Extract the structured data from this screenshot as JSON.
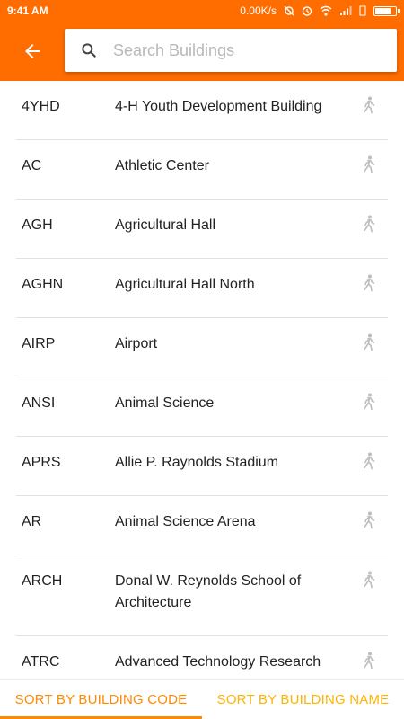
{
  "status_bar": {
    "time": "9:41 AM",
    "network_speed": "0.00K/s",
    "battery_level": 0.8
  },
  "header": {
    "back_icon": "arrow-back-icon",
    "search": {
      "icon": "search-icon",
      "placeholder": "Search Buildings",
      "value": ""
    }
  },
  "buildings": [
    {
      "code": "4YHD",
      "name": "4-H Youth Development Building"
    },
    {
      "code": "AC",
      "name": "Athletic Center"
    },
    {
      "code": "AGH",
      "name": "Agricultural Hall"
    },
    {
      "code": "AGHN",
      "name": "Agricultural Hall North"
    },
    {
      "code": "AIRP",
      "name": "Airport"
    },
    {
      "code": "ANSI",
      "name": "Animal Science"
    },
    {
      "code": "APRS",
      "name": "Allie P. Raynolds Stadium"
    },
    {
      "code": "AR",
      "name": "Animal Science Arena"
    },
    {
      "code": "ARCH",
      "name": "Donal W. Reynolds School of Architecture"
    },
    {
      "code": "ATRC",
      "name": "Advanced Technology Research"
    }
  ],
  "tabs": {
    "sort_code": "SORT BY BUILDING CODE",
    "sort_name": "SORT BY BUILDING NAME",
    "active": "sort_code"
  },
  "colors": {
    "primary": "#ff6d00",
    "tab_active": "#ff8a00",
    "tab_inactive": "#ffb300",
    "walk_icon": "#bdbdbd"
  }
}
